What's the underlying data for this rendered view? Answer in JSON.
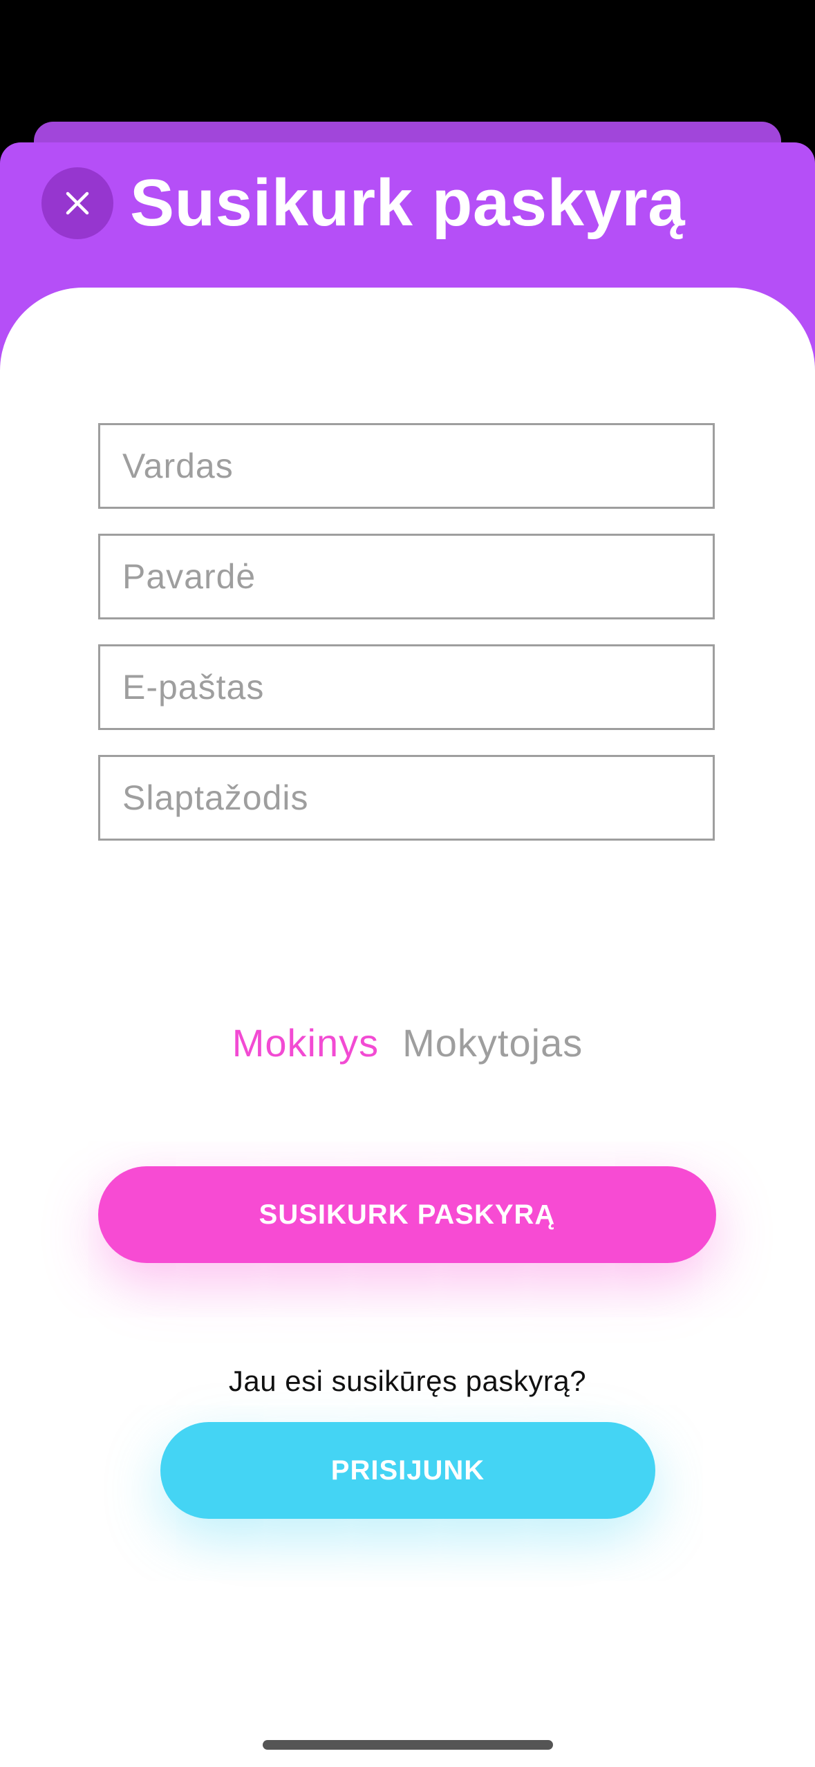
{
  "header": {
    "title": "Susikurk paskyrą",
    "close_icon": "close-icon"
  },
  "form": {
    "first_name_placeholder": "Vardas",
    "last_name_placeholder": "Pavardė",
    "email_placeholder": "E-paštas",
    "password_placeholder": "Slaptažodis"
  },
  "roles": {
    "options": [
      "Mokinys",
      "Mokytojas"
    ],
    "selected": "Mokinys"
  },
  "actions": {
    "create_account_label": "SUSIKURK PASKYRĄ",
    "already_have_account_text": "Jau esi susikūręs paskyrą?",
    "login_label": "PRISIJUNK"
  },
  "colors": {
    "header_purple": "#b54ff7",
    "accent_pink": "#f74bd3",
    "accent_cyan": "#44d4f4",
    "placeholder_gray": "#9e9e9e"
  }
}
